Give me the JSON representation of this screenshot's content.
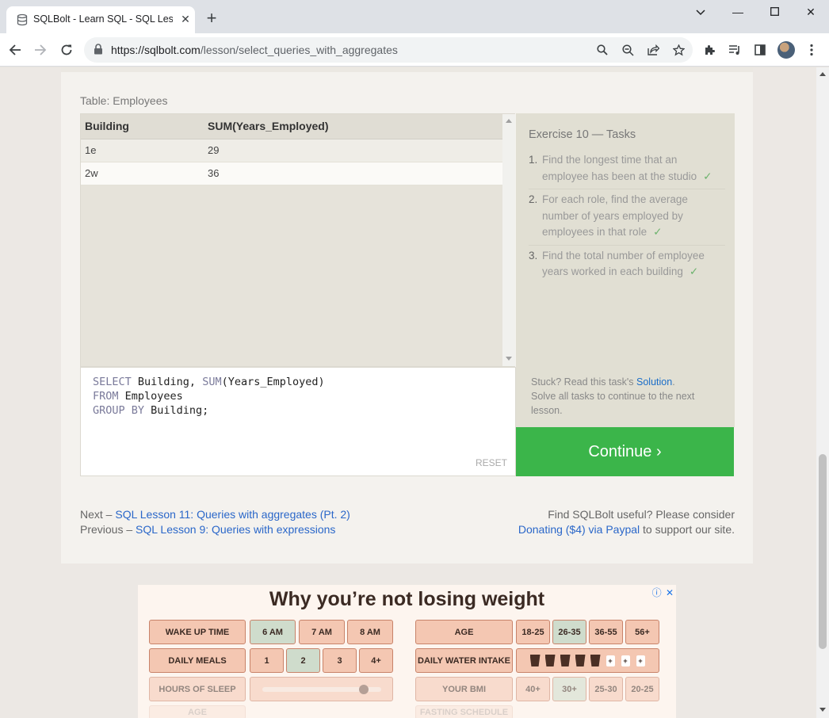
{
  "browser": {
    "tab_title": "SQLBolt - Learn SQL - SQL Lesson",
    "url_host": "https://sqlbolt.com",
    "url_path": "/lesson/select_queries_with_aggregates"
  },
  "lesson": {
    "table_label": "Table: Employees",
    "results": {
      "columns": [
        "Building",
        "SUM(Years_Employed)"
      ],
      "rows": [
        [
          "1e",
          "29"
        ],
        [
          "2w",
          "36"
        ]
      ]
    },
    "query_lines": {
      "l1_kw": "SELECT",
      "l1_rest": " Building, ",
      "l1_fn": "SUM",
      "l1_args": "(Years_Employed)",
      "l2_kw": "FROM",
      "l2_rest": " Employees",
      "l3_kw": "GROUP BY",
      "l3_rest": " Building;"
    },
    "reset_label": "RESET",
    "exercise_title": "Exercise 10 — Tasks",
    "tasks": [
      {
        "num": "1.",
        "text": "Find the longest time that an employee has been at the studio",
        "check": "✓"
      },
      {
        "num": "2.",
        "text": "For each role, find the average number of years employed by employees in that role",
        "check": "✓"
      },
      {
        "num": "3.",
        "text": "Find the total number of employee years worked in each building",
        "check": "✓"
      }
    ],
    "stuck_prefix": "Stuck? Read this task's ",
    "solution_link": "Solution",
    "stuck_suffix": ".",
    "solve_all": "Solve all tasks to continue to the next lesson.",
    "continue_label": "Continue ›",
    "next_prefix": "Next – ",
    "next_link": "SQL Lesson 11: Queries with aggregates (Pt. 2)",
    "prev_prefix": "Previous – ",
    "prev_link": "SQL Lesson 9: Queries with expressions",
    "donate_line1": "Find SQLBolt useful? Please consider",
    "donate_link": "Donating ($4) via Paypal",
    "donate_suffix": " to support our site."
  },
  "ad": {
    "headline": "Why you’re not losing weight",
    "rows": {
      "wake_label": "WAKE UP TIME",
      "wake_opts": [
        "6 AM",
        "7 AM",
        "8 AM"
      ],
      "age_label": "AGE",
      "age_opts": [
        "18-25",
        "26-35",
        "36-55",
        "56+"
      ],
      "meals_label": "DAILY MEALS",
      "meals_opts": [
        "1",
        "2",
        "3",
        "4+"
      ],
      "water_label": "DAILY WATER INTAKE",
      "sleep_label": "HOURS OF SLEEP",
      "bmi_label": "YOUR BMI",
      "bmi_opts": [
        "40+",
        "30+",
        "25-30",
        "20-25"
      ],
      "row4_left": "AGE",
      "row4_right": "FASTING SCHEDULE"
    }
  },
  "colors": {
    "continue_green": "#3bb54a",
    "link_blue": "#2a67c9",
    "check_green": "#6db36d"
  }
}
